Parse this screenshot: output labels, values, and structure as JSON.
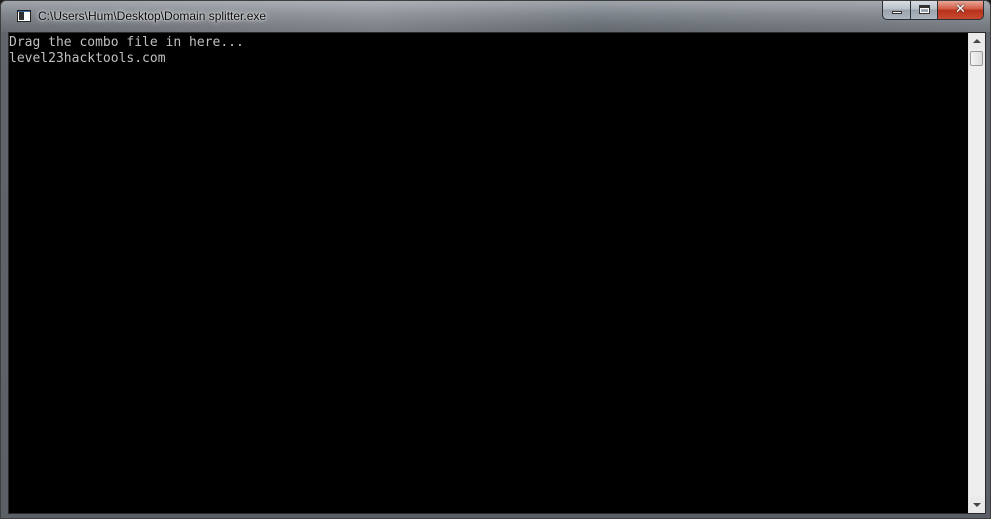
{
  "window": {
    "title": "C:\\Users\\Hum\\Desktop\\Domain splitter.exe",
    "icon": "console-window-icon",
    "buttons": {
      "minimize": "minimize-icon",
      "maximize": "maximize-icon",
      "close": "close-icon"
    },
    "close_glyph": "✕"
  },
  "console": {
    "lines": [
      "Drag the combo file in here...",
      "level23hacktools.com"
    ],
    "text_color": "#c0c0c0",
    "background": "#000000"
  },
  "scrollbar": {
    "position": 0
  }
}
